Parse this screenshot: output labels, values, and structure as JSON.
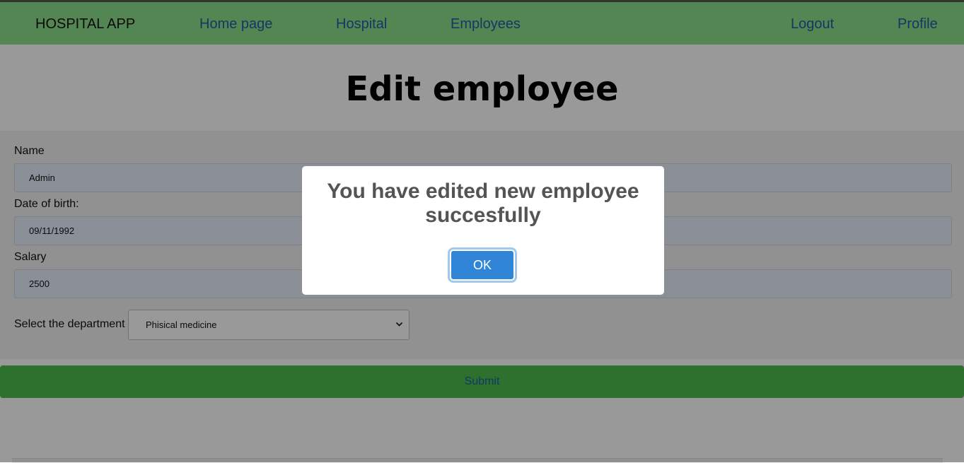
{
  "navbar": {
    "brand": "HOSPITAL APP",
    "links": [
      "Home page",
      "Hospital",
      "Employees"
    ],
    "right_links": [
      "Logout",
      "Profile"
    ]
  },
  "page": {
    "title": "Edit employee"
  },
  "form": {
    "name_label": "Name",
    "name_value": "Admin",
    "dob_label": "Date of birth:",
    "dob_value": "09/11/1992",
    "salary_label": "Salary",
    "salary_value": "2500",
    "department_label": "Select the department",
    "department_selected": "Phisical medicine",
    "submit_label": "Submit"
  },
  "modal": {
    "message_line1": "You have edited new employee",
    "message_line2": "succesfully",
    "ok_label": "OK"
  },
  "colors": {
    "navbar_bg": "#8be08b",
    "link": "#1f5ea8",
    "submit_bg": "#4dbb4d",
    "ok_button": "#3085d6"
  }
}
